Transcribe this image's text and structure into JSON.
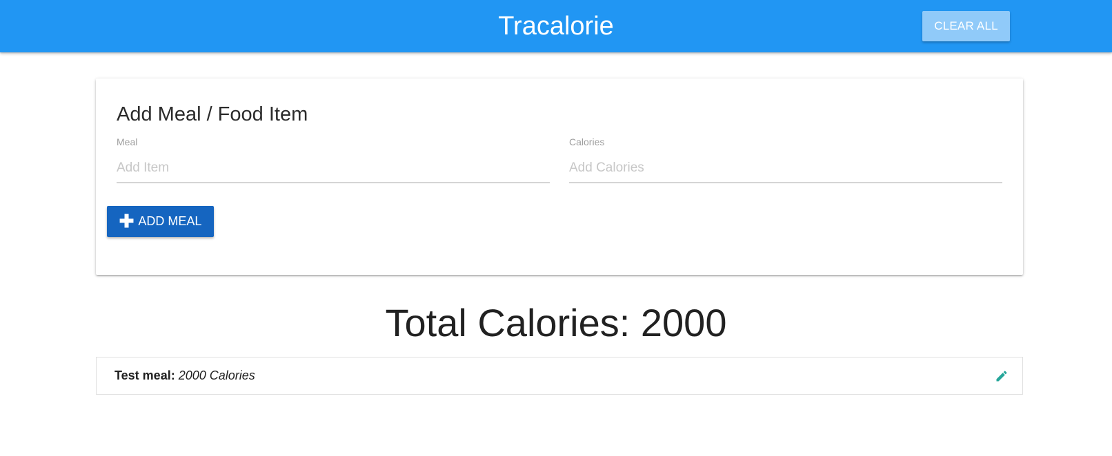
{
  "navbar": {
    "brand": "Tracalorie",
    "clear_all_label": "CLEAR ALL",
    "bg_color": "#2196f3"
  },
  "form": {
    "title": "Add Meal / Food Item",
    "meal": {
      "label": "Meal",
      "placeholder": "Add Item",
      "value": ""
    },
    "calories": {
      "label": "Calories",
      "placeholder": "Add Calories",
      "value": ""
    },
    "add_button_label": "ADD MEAL",
    "add_button_icon": "plus-icon",
    "add_button_color": "#1565c0"
  },
  "total": {
    "text": "Total Calories: 2000"
  },
  "items": [
    {
      "name": "Test meal:",
      "calories": "2000 Calories",
      "action_icon": "pencil-icon",
      "action_color": "#26a69a"
    }
  ]
}
